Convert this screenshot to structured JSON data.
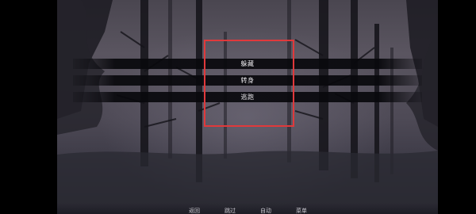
{
  "choices": [
    {
      "label": "躲藏"
    },
    {
      "label": "转身"
    },
    {
      "label": "逃跑"
    }
  ],
  "bottom_menu": {
    "back": "返回",
    "skip": "跳过",
    "auto": "自动",
    "menu": "菜单"
  },
  "colors": {
    "highlight": "#e0393b",
    "choice_bar": "#08080c",
    "choice_text": "#e8e6ea",
    "bottom_text": "#c9c7cf"
  },
  "icons": [
    "forest-background"
  ]
}
